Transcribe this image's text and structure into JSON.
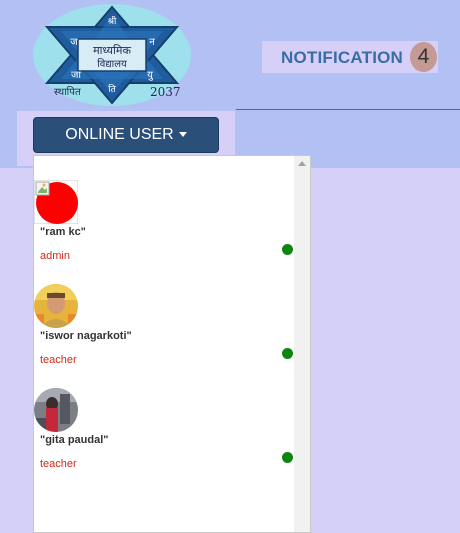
{
  "logo": {
    "top_letter": "श्री",
    "left_top": "ज",
    "right_top": "न",
    "left_bottom": "जा",
    "right_bottom": "यु",
    "bottom_letter": "ति",
    "school_line1": "माध्यमिक",
    "school_line2": "विद्यालय",
    "established_label": "स्थापित",
    "year": "2037"
  },
  "notification": {
    "label": "NOTIFICATION",
    "count": "4"
  },
  "online_user_button": {
    "label": "ONLINE USER"
  },
  "users": [
    {
      "name": "\"ram kc\"",
      "role": "admin",
      "status": "online"
    },
    {
      "name": "\"iswor nagarkoti\"",
      "role": "teacher",
      "status": "online"
    },
    {
      "name": "\"gita paudal\"",
      "role": "teacher",
      "status": "online"
    }
  ],
  "colors": {
    "header": "#b3c0f4",
    "page": "#d4cff7",
    "button": "#2a4f78",
    "role_text": "#d12a1a",
    "online_dot": "#0d860d"
  }
}
